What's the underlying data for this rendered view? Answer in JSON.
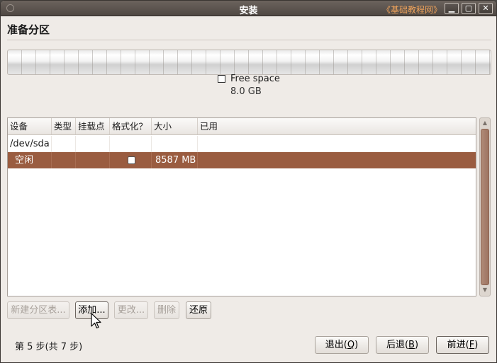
{
  "window": {
    "title": "安装",
    "watermark": "《基础教程网》",
    "minimize_glyph": "▁",
    "maximize_glyph": "▢",
    "close_glyph": "✕"
  },
  "page": {
    "title": "准备分区"
  },
  "disk": {
    "legend_name": "Free space",
    "legend_size": "8.0 GB"
  },
  "table": {
    "columns": [
      "设备",
      "类型",
      "挂载点",
      "格式化？",
      "大小",
      "已用"
    ],
    "rows": [
      {
        "device": "/dev/sda",
        "type": "",
        "mount": "",
        "format": false,
        "size": "",
        "used": ""
      },
      {
        "device": "空闲",
        "type": "",
        "mount": "",
        "format": false,
        "size": "8587 MB",
        "used": "",
        "selected": true
      }
    ]
  },
  "partition_buttons": {
    "new_table": "新建分区表...",
    "add": "添加...",
    "change": "更改...",
    "delete": "删除",
    "revert": "还原"
  },
  "footer": {
    "step_text": "第 5 步(共 7 步)",
    "quit_prefix": "退出(",
    "quit_key": "Q",
    "back_prefix": "后退(",
    "back_key": "B",
    "forward_prefix": "前进(",
    "forward_key": "F",
    "close_paren": ")"
  },
  "colors": {
    "selection": "#9a5c40",
    "titlebar": "#5a534e",
    "watermark": "#f0a35b"
  }
}
